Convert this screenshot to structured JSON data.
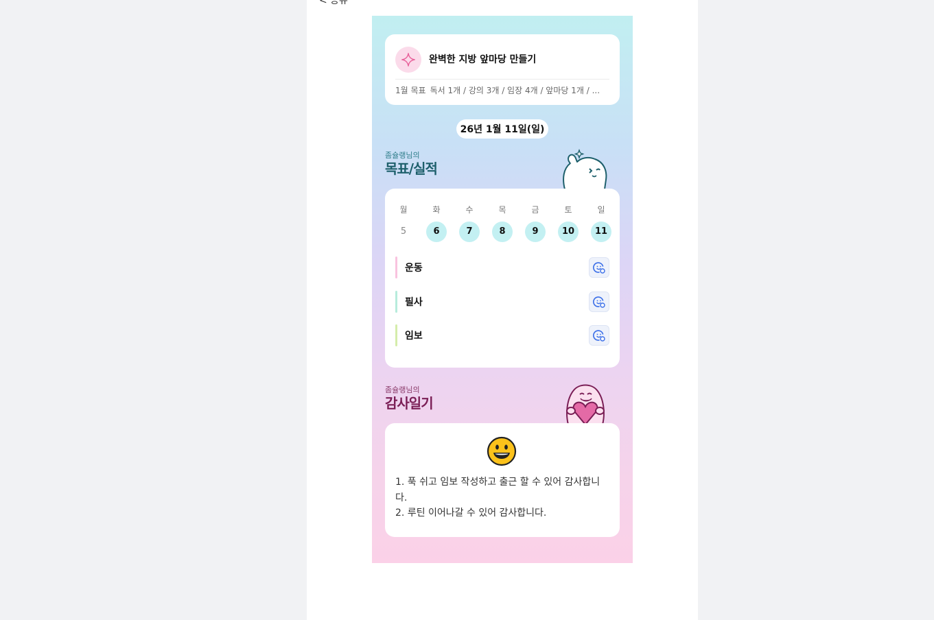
{
  "top_fragment": "< 공유",
  "goal": {
    "title": "완벽한 지방 앞마당 만들기",
    "month_label": "1월 목표",
    "summary": "독서 1개 / 강의 3개 / 임장 4개 / 앞마당 1개 / ...",
    "icon": "sparkle-icon",
    "accent": "#e8609a"
  },
  "date_label": "26년 1월 11일(일)",
  "performance_section": {
    "owner": "좀슐랭님의",
    "title": "목표/실적"
  },
  "week": {
    "weekdays": [
      "월",
      "화",
      "수",
      "목",
      "금",
      "토",
      "일"
    ],
    "days": [
      {
        "num": "5",
        "active": false
      },
      {
        "num": "6",
        "active": true
      },
      {
        "num": "7",
        "active": true
      },
      {
        "num": "8",
        "active": true
      },
      {
        "num": "9",
        "active": true
      },
      {
        "num": "10",
        "active": true
      },
      {
        "num": "11",
        "active": true
      }
    ],
    "active_color": "#c3f0f2"
  },
  "habits": [
    {
      "label": "운동",
      "color": "#f9c3df",
      "icon": "add-reaction-icon"
    },
    {
      "label": "필사",
      "color": "#b7ecdc",
      "icon": "add-reaction-icon"
    },
    {
      "label": "임보",
      "color": "#d5edab",
      "icon": "add-reaction-icon"
    }
  ],
  "gratitude_section": {
    "owner": "좀슐랭님의",
    "title": "감사일기"
  },
  "gratitude": {
    "emoji": "smiling-face-icon",
    "lines": [
      "1. 푹 쉬고 임보 작성하고 출근 할 수 있어 감사합니",
      "다.",
      "2. 루틴 이어나갈 수 있어 감사합니다."
    ]
  }
}
